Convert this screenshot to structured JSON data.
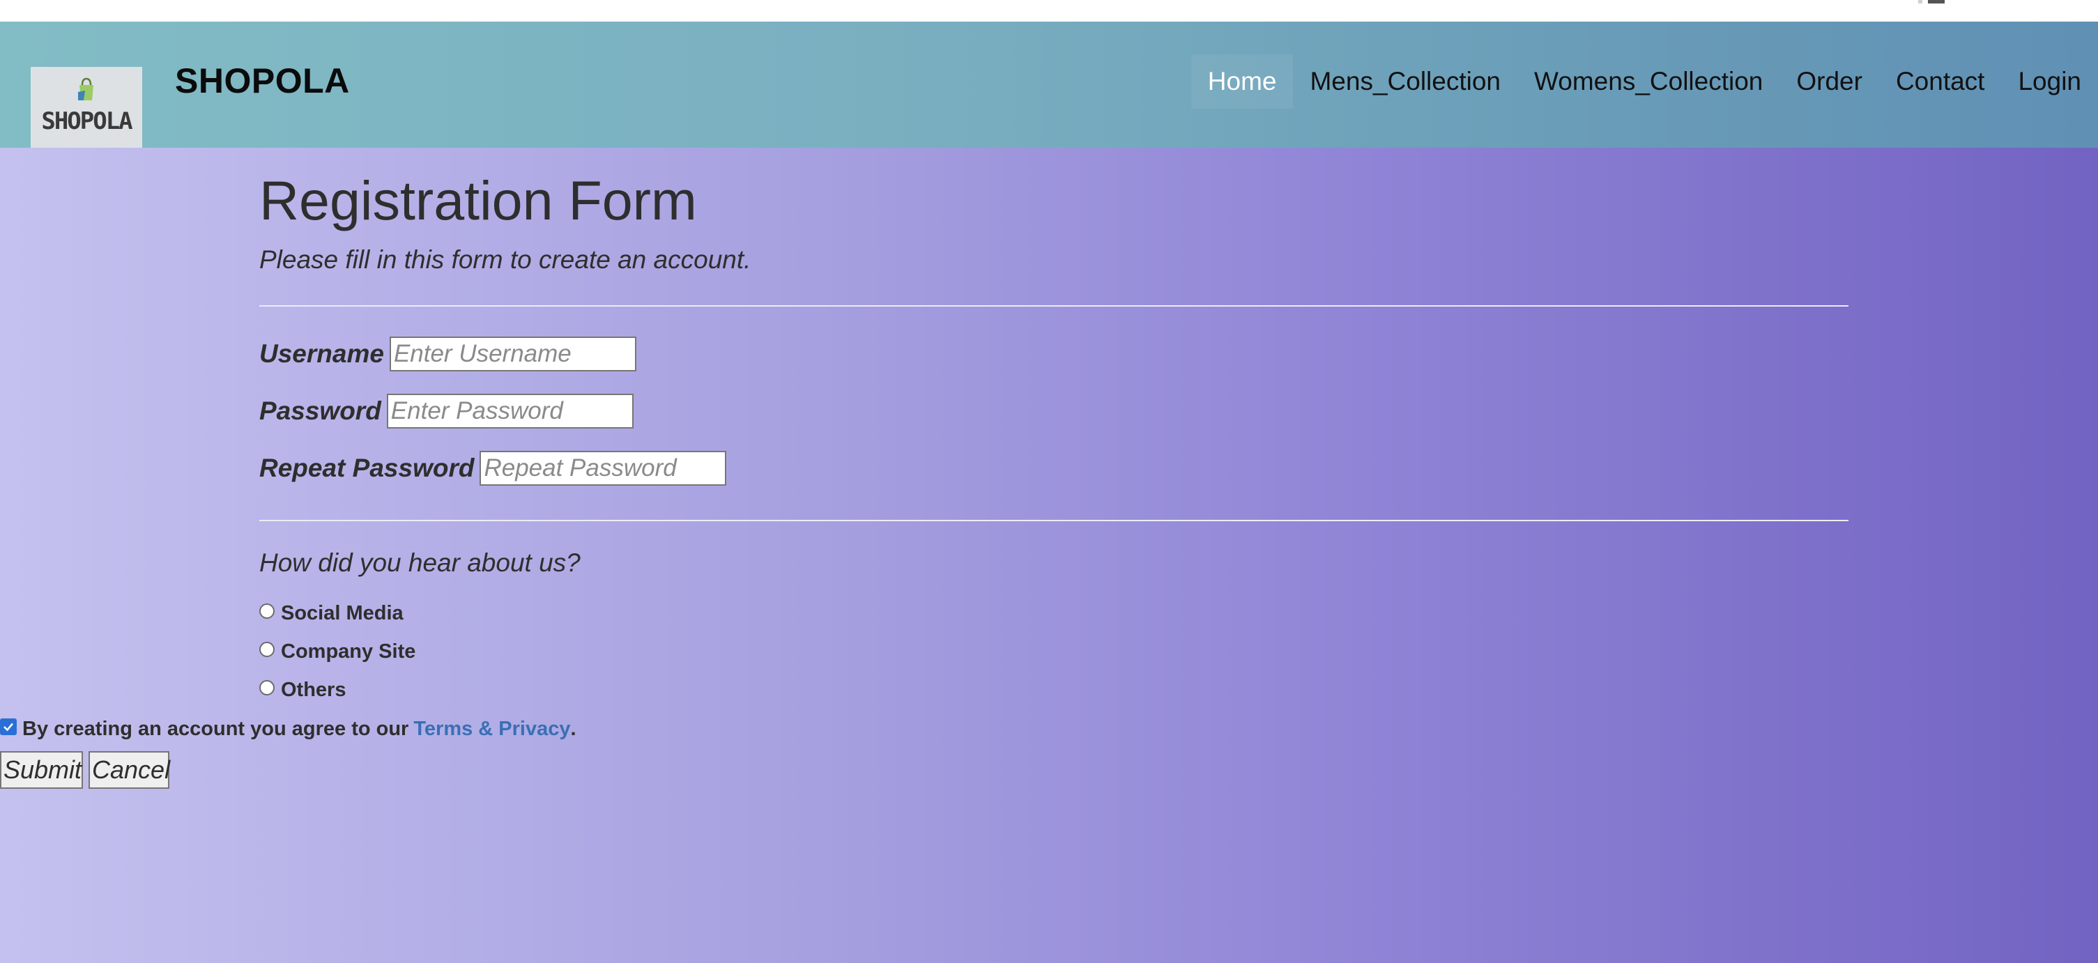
{
  "brand": {
    "name": "SHOPOLA",
    "logo_text": "SHOPOLA",
    "logo_icon": "shopping-bag-icon"
  },
  "nav": {
    "items": [
      {
        "label": "Home",
        "active": true
      },
      {
        "label": "Mens_Collection",
        "active": false
      },
      {
        "label": "Womens_Collection",
        "active": false
      },
      {
        "label": "Order",
        "active": false
      },
      {
        "label": "Contact",
        "active": false
      },
      {
        "label": "Login",
        "active": false
      }
    ]
  },
  "form": {
    "title": "Registration Form",
    "subtitle": "Please fill in this form to create an account.",
    "fields": [
      {
        "label": "Username",
        "placeholder": "Enter Username",
        "value": ""
      },
      {
        "label": "Password",
        "placeholder": "Enter Password",
        "value": ""
      },
      {
        "label": "Repeat Password",
        "placeholder": "Repeat Password",
        "value": ""
      }
    ],
    "question": "How did you hear about us?",
    "options": [
      "Social Media",
      "Company Site",
      "Others"
    ],
    "terms": {
      "text": "By creating an account you agree to our",
      "link": "Terms & Privacy",
      "suffix": ".",
      "checked": true
    },
    "submit_label": "Submit",
    "cancel_label": "Cancel"
  },
  "colors": {
    "nav_active_text": "#ffffff",
    "link": "#3a6fb5",
    "checkbox": "#2a6fd6"
  }
}
